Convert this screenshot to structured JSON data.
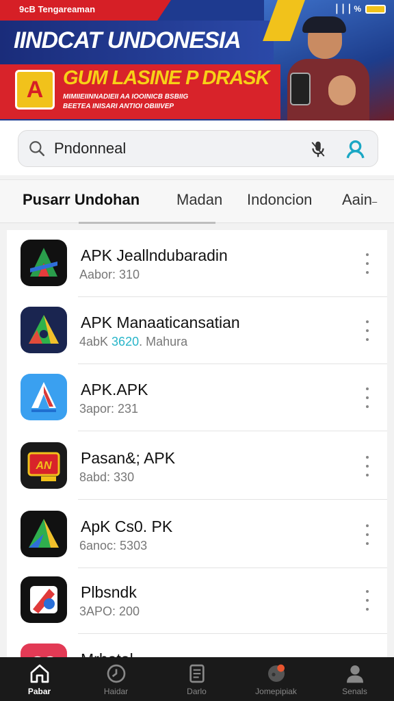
{
  "status_bar": {
    "left_text": "9cB Tengareaman",
    "signal": "▕▕▕",
    "wifi_pct": "%"
  },
  "banner": {
    "title": "IINDCAT UNDONESIA",
    "subtitle": "GUM LASINE P DRASK",
    "small_line1": "MIMIIEIINNADIEII AA IOOINICB BSBIIG",
    "small_line2": "BEETEA INISARI ANTIOI OBIIIVEP"
  },
  "search": {
    "value": "Pndonneal",
    "placeholder": ""
  },
  "tabs": [
    {
      "label": "Pusarr Undohan",
      "active": true
    },
    {
      "label": "Madan",
      "active": false
    },
    {
      "label": "Indoncion",
      "active": false
    },
    {
      "label": "Aain",
      "active": false
    }
  ],
  "apps": [
    {
      "title": "APK Jeallndubaradin",
      "sub": "Aabor: 310",
      "sub_hl": "",
      "sub_tail": "",
      "icon": "A-arrow-icon",
      "colors": [
        "#111111",
        "#2a9d4b",
        "#e63c3c",
        "#2f6fd8"
      ]
    },
    {
      "title": "APK Manaaticansatian",
      "sub": "4abK ",
      "sub_hl": "3620",
      "sub_tail": ". Mahura",
      "icon": "A-triangle-icon",
      "colors": [
        "#1a2550",
        "#2fb24b",
        "#f2c02b",
        "#e14b3a"
      ]
    },
    {
      "title": "APK.APK",
      "sub": "3apor: 231",
      "sub_hl": "",
      "sub_tail": "",
      "icon": "A-blue-icon",
      "colors": [
        "#3aa0f0",
        "#d93a3a",
        "#ffffff",
        "#1f6fd0"
      ]
    },
    {
      "title": "Pasan&; APK",
      "sub": "8abd: 330",
      "sub_hl": "",
      "sub_tail": "",
      "icon": "APK-card-icon",
      "colors": [
        "#1a1a1a",
        "#d8232a",
        "#f1c21b",
        "#ffffff"
      ]
    },
    {
      "title": "ApK Cs0. PK",
      "sub": "6anoc: 5303",
      "sub_hl": "",
      "sub_tail": "",
      "icon": "A-green-icon",
      "colors": [
        "#111111",
        "#2fae4e",
        "#f2c02b",
        "#2f6fd8"
      ]
    },
    {
      "title": "Plbsndk",
      "sub": "3APO: 200",
      "sub_hl": "",
      "sub_tail": "",
      "icon": "pen-red-icon",
      "colors": [
        "#111111",
        "#ffffff",
        "#e03a3a",
        "#2a6fd8"
      ]
    },
    {
      "title": "Mrhatal",
      "sub": "",
      "sub_hl": "",
      "sub_tail": "",
      "icon": "heart-red-icon",
      "colors": [
        "#e23a55",
        "#ffffff",
        "#ffffff",
        "#ffffff"
      ]
    }
  ],
  "bottom_nav": [
    {
      "label": "Pabar",
      "icon": "home-icon",
      "active": true
    },
    {
      "label": "Haidar",
      "icon": "clock-icon",
      "active": false
    },
    {
      "label": "Darlo",
      "icon": "document-icon",
      "active": false
    },
    {
      "label": "Jomepipiak",
      "icon": "chat-icon",
      "active": false
    },
    {
      "label": "Senals",
      "icon": "profile-icon",
      "active": false
    }
  ]
}
